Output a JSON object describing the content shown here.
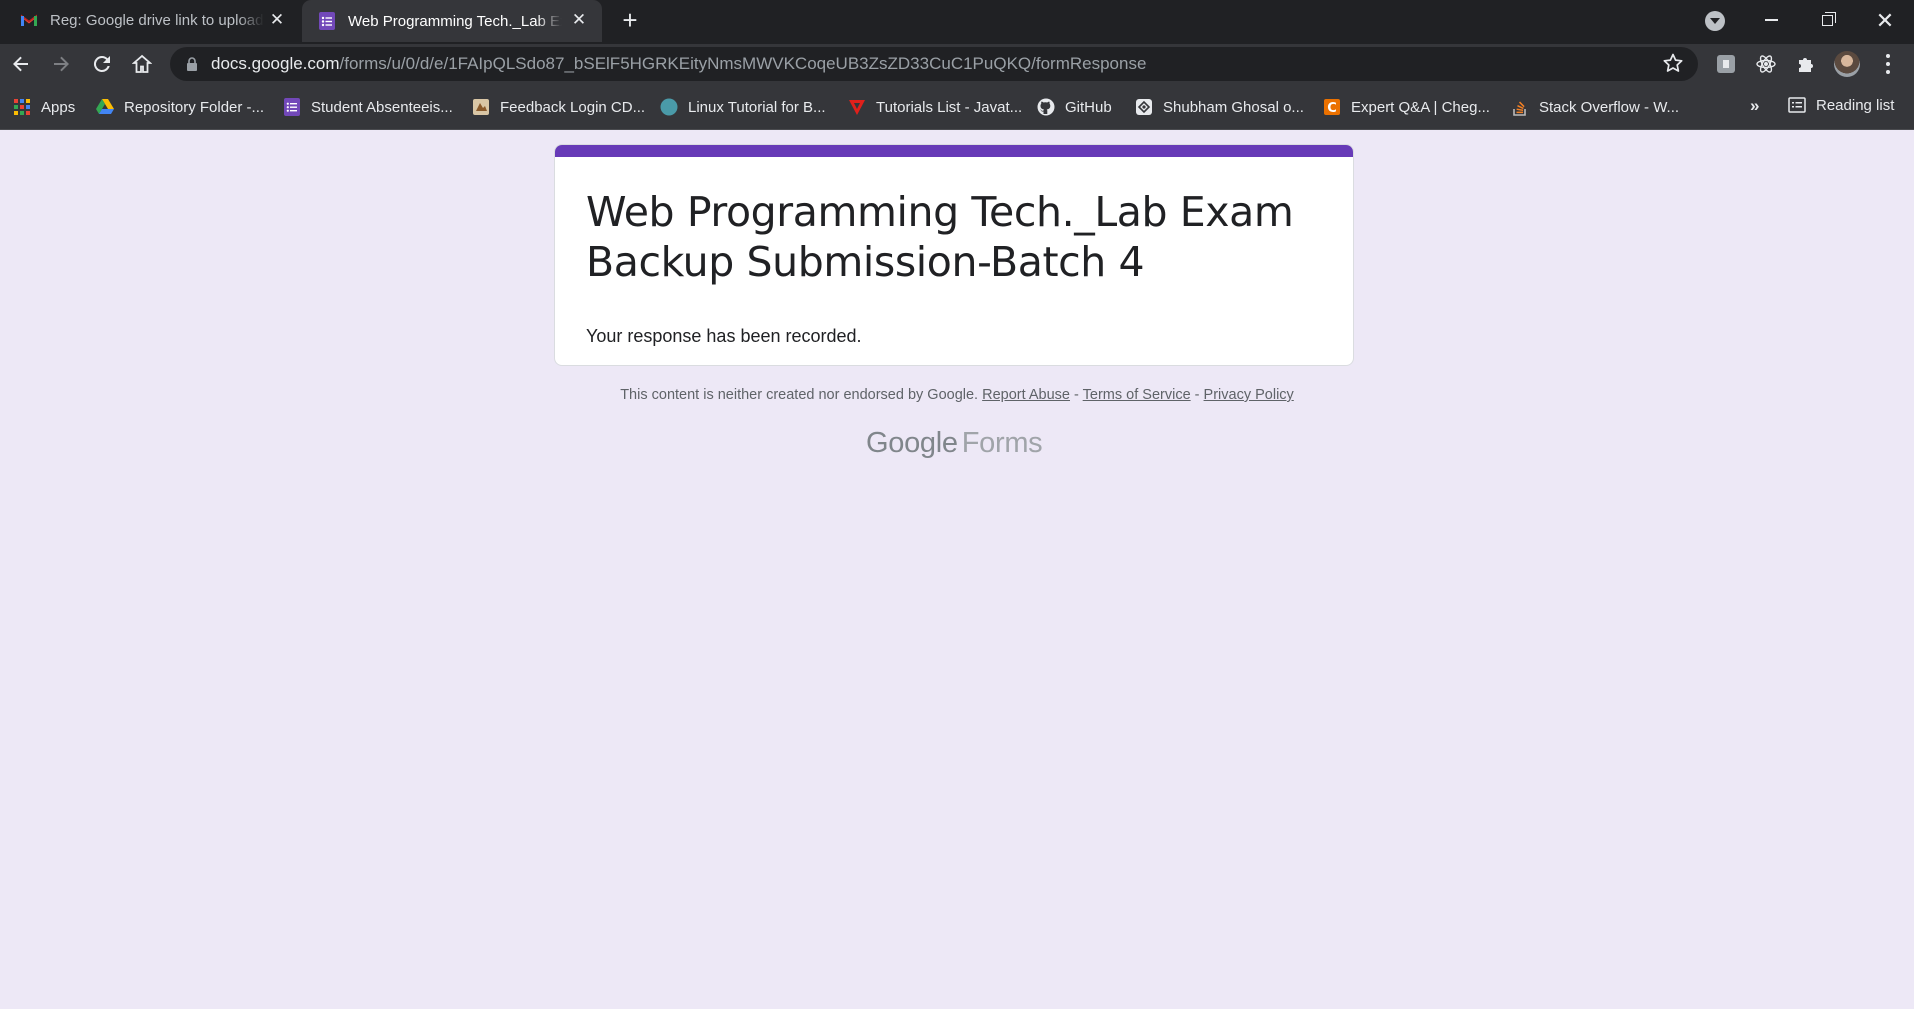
{
  "tabs": [
    {
      "title": "Reg: Google drive link to upload",
      "favicon": "gmail-icon",
      "active": false
    },
    {
      "title": "Web Programming Tech._Lab Exam Backup Submission-Batch 4",
      "favicon": "google-forms-icon",
      "active": true
    }
  ],
  "omnibox": {
    "host": "docs.google.com",
    "path": "/forms/u/0/d/e/1FAIpQLSdo87_bSElF5HGRKEityNmsMWVKCoqeUB3ZsZD33CuC1PuQKQ/formResponse"
  },
  "bookmarks": {
    "items": [
      {
        "label": "Apps",
        "icon": "apps-grid-icon"
      },
      {
        "label": "Repository Folder -...",
        "icon": "google-drive-icon"
      },
      {
        "label": "Student Absenteeis...",
        "icon": "google-forms-icon"
      },
      {
        "label": "Feedback Login CD...",
        "icon": "feedback-icon"
      },
      {
        "label": "Linux Tutorial for B...",
        "icon": "globe-icon"
      },
      {
        "label": "Tutorials List - Javat...",
        "icon": "javatpoint-icon"
      },
      {
        "label": "GitHub",
        "icon": "github-icon"
      },
      {
        "label": "Shubham Ghosal o...",
        "icon": "codechef-icon"
      },
      {
        "label": "Expert Q&A | Cheg...",
        "icon": "chegg-icon"
      },
      {
        "label": "Stack Overflow - W...",
        "icon": "stackoverflow-icon"
      }
    ],
    "more": "»",
    "reading_list": "Reading list"
  },
  "form": {
    "title": "Web Programming Tech._Lab Exam Backup Submission-Batch 4",
    "confirmation": "Your response has been recorded.",
    "accent_color": "#673ab7",
    "background_color": "#ede8f6"
  },
  "footer": {
    "disclaimer": "This content is neither created nor endorsed by Google.",
    "separator": "-",
    "report_abuse": "Report Abuse",
    "terms": "Terms of Service",
    "privacy": "Privacy Policy",
    "logo_google": "Google",
    "logo_forms": "Forms"
  }
}
